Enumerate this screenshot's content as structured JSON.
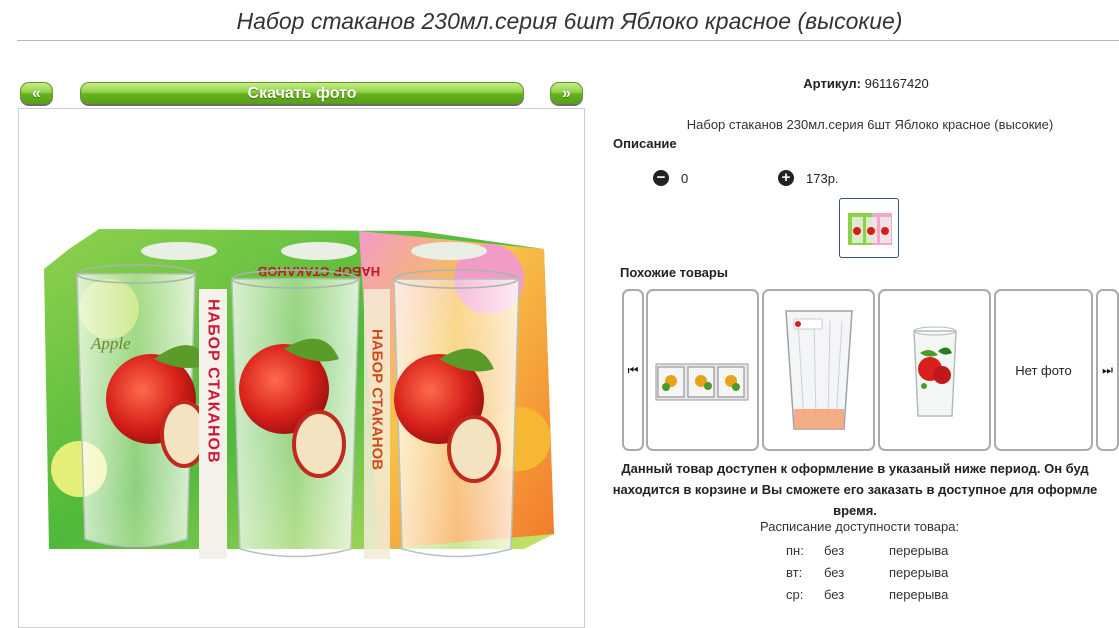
{
  "page": {
    "title": "Набор стаканов 230мл.серия 6шт Яблоко красное (высокие)"
  },
  "photo_toolbar": {
    "prev_label": "«",
    "download_label": "Скачать фото",
    "next_label": "»"
  },
  "product": {
    "article_label": "Артикул:",
    "article_value": "961167420",
    "name": "Набор стаканов 230мл.серия 6шт Яблоко красное (высокие)",
    "description_label": "Описание",
    "quantity": "0",
    "price": "173р."
  },
  "photo": {
    "box_side_text": "НАБОР СТАКАНОВ",
    "box_top_text": "НАБОР СТАКАНОВ",
    "glass_text": "Apple"
  },
  "similar": {
    "label": "Похожие товары",
    "prev_icon": "skip-back-icon",
    "next_icon": "skip-forward-icon",
    "no_photo_label": "Нет фото"
  },
  "availability": {
    "notice_line1": "Данный товар доступен к оформление в указаный ниже период. Он буд",
    "notice_line2": "находится в корзине и Вы сможете его заказать в доступное для оформле",
    "notice_line3": "время.",
    "schedule_title": "Расписание доступности товара:",
    "rows": [
      {
        "day": "пн:",
        "from": "без",
        "to": "перерыва"
      },
      {
        "day": "вт:",
        "from": "без",
        "to": "перерыва"
      },
      {
        "day": "ср:",
        "from": "без",
        "to": "перерыва"
      }
    ]
  },
  "colors": {
    "button_green": "#66b21c",
    "frame_border": "#cfcfcf",
    "selected_thumb_border": "#38527a"
  }
}
